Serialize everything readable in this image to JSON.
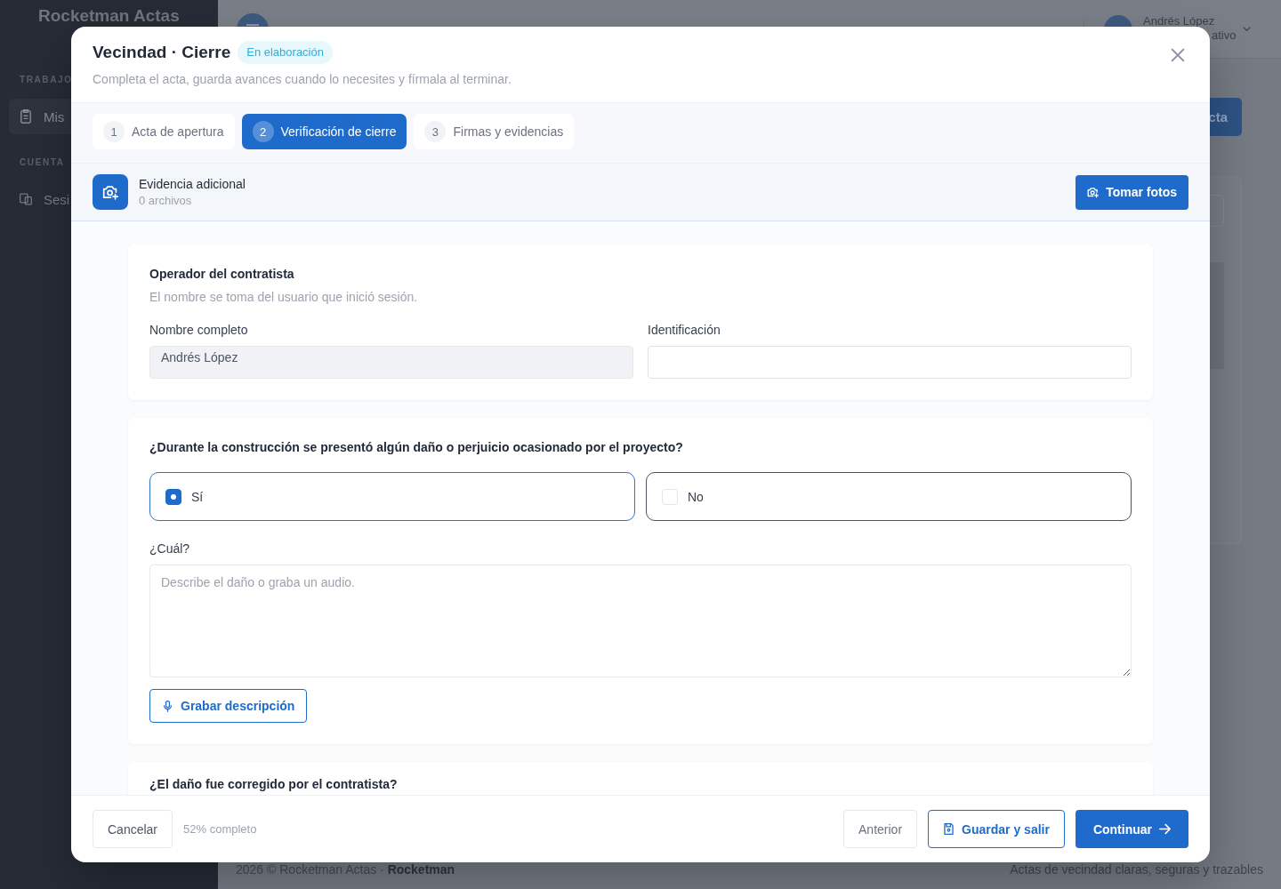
{
  "app": {
    "brand": "Rocketman Actas",
    "sidebar": [
      {
        "heading": "TRABAJO",
        "items": [
          {
            "label": "Mis",
            "selected": true
          }
        ]
      },
      {
        "heading": "CUENTA",
        "items": [
          {
            "label": "Sesi",
            "selected": false
          }
        ]
      }
    ],
    "header": {
      "user_name": "Andrés López",
      "user_role": "ativo"
    },
    "page_button": "cta",
    "footer": {
      "copyright": "2026 © Rocketman Actas · **Rocketman**",
      "tagline": "Actas de vecindad claras, seguras y trazables"
    }
  },
  "modal": {
    "title": "Vecindad · Cierre",
    "status": "En elaboración",
    "subtitle": "Completa el acta, guarda avances cuando lo necesites y fírmala al terminar.",
    "steps": [
      {
        "number": "1",
        "label": "Acta de apertura",
        "selected": false
      },
      {
        "number": "2",
        "label": "Verificación de cierre",
        "selected": true
      },
      {
        "number": "3",
        "label": "Firmas y evidencias",
        "selected": false
      }
    ],
    "evidence": {
      "title": "Evidencia adicional",
      "count": "0 archivos",
      "button": "Tomar fotos"
    },
    "sections": [
      {
        "kind": "fields",
        "title": "Operador del contratista",
        "description": "El nombre se toma del usuario que inició sesión.",
        "fields": [
          {
            "label": "Nombre completo",
            "value": "Andrés López",
            "disabled": true
          },
          {
            "label": "Identificación",
            "disabled": false
          }
        ]
      },
      {
        "kind": "question",
        "question": "¿Durante la construcción se presentó algún daño o perjuicio ocasionado por el proyecto?",
        "options": [
          {
            "label": "Sí",
            "selected": true,
            "hovered": false
          },
          {
            "label": "No",
            "selected": false,
            "hovered": true
          }
        ],
        "detail": {
          "label": "¿Cuál?",
          "placeholder": "Describe el daño o graba un audio.",
          "button": "Grabar descripción"
        }
      },
      {
        "kind": "question",
        "question": "¿El daño fue corregido por el contratista?"
      }
    ],
    "footer": {
      "cancel": "Cancelar",
      "progress": "52% completo",
      "previous": "Anterior",
      "save": "Guardar y salir",
      "next": "Continuar"
    }
  }
}
